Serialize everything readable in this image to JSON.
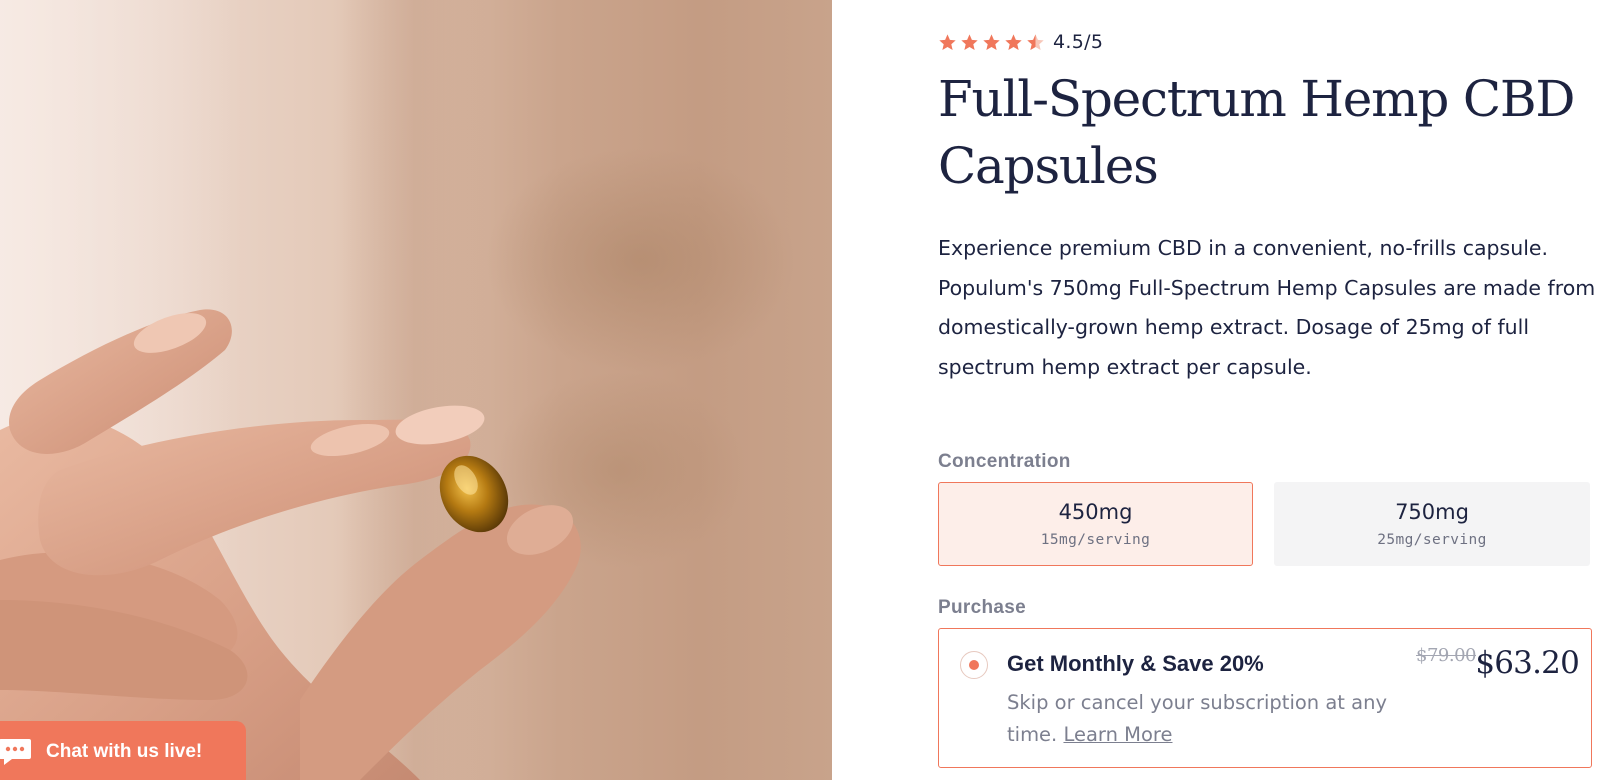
{
  "hero_image": {
    "alt": "Hand holding an amber softgel capsule"
  },
  "chat": {
    "label": "Chat with us live!",
    "icon": "chat-bubble-icon"
  },
  "product": {
    "rating": {
      "value": "4.5/5",
      "stars_filled": 4.5,
      "stars_total": 5,
      "star_color": "#f0775b"
    },
    "title": "Full-Spectrum Hemp CBD Capsules",
    "description": "Experience premium CBD in a convenient, no-frills capsule. Populum's 750mg Full-Spectrum Hemp Capsules are made from domestically-grown hemp extract. Dosage of 25mg of full spectrum hemp extract per capsule."
  },
  "concentration": {
    "label": "Concentration",
    "options": [
      {
        "value": "450mg",
        "sub": "15mg/serving",
        "selected": true
      },
      {
        "value": "750mg",
        "sub": "25mg/serving",
        "selected": false
      }
    ]
  },
  "purchase": {
    "label": "Purchase",
    "plan": {
      "title": "Get Monthly & Save 20%",
      "description": "Skip or cancel your subscription at any time.",
      "learn_more": "Learn More",
      "old_price": "$79.00",
      "price": "$63.20",
      "selected": true
    }
  },
  "colors": {
    "accent": "#f0775b",
    "text": "#1d2340",
    "muted": "#7c7f8f",
    "selected_bg": "#fdeee9",
    "option_bg": "#f4f4f5"
  }
}
